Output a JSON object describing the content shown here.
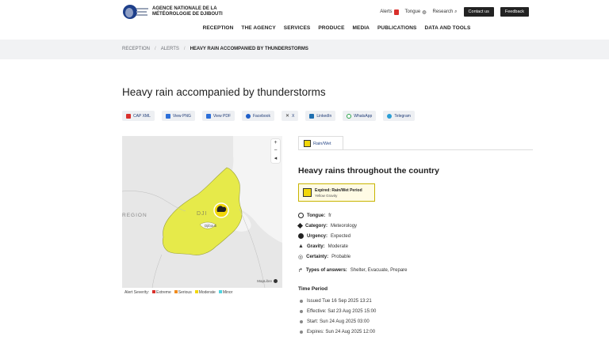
{
  "header": {
    "logo_text": "AGENCE NATIONALE DE LA MÉTÉOROLOGIE DE DJIBOUTI",
    "alerts_label": "Alerts",
    "tongue_label": "Tongue",
    "research_label": "Research",
    "contact_label": "Contact us",
    "feedback_label": "Feedback"
  },
  "nav": [
    "RECEPTION",
    "THE AGENCY",
    "SERVICES",
    "PRODUCE",
    "MEDIA",
    "PUBLICATIONS",
    "DATA AND TOOLS"
  ],
  "breadcrumb": {
    "home": "RECEPTION",
    "alerts": "ALERTS",
    "current": "HEAVY RAIN ACCOMPANIED BY THUNDERSTORMS"
  },
  "page_title": "Heavy rain accompanied by thunderstorms",
  "share_buttons": [
    {
      "label": "CAP XML",
      "icon": "file-icon",
      "color": "#d9302c"
    },
    {
      "label": "View PNG",
      "icon": "image-icon",
      "color": "#2c6fd9"
    },
    {
      "label": "View PDF",
      "icon": "pdf-icon",
      "color": "#2c6fd9"
    },
    {
      "label": "Facebook",
      "icon": "facebook-icon",
      "color": "#1f5fc9"
    },
    {
      "label": "X",
      "icon": "x-icon",
      "color": "#333333"
    },
    {
      "label": "LinkedIn",
      "icon": "linkedin-icon",
      "color": "#1f6fb0"
    },
    {
      "label": "WhatsApp",
      "icon": "whatsapp-icon",
      "color": "#2aa34a"
    },
    {
      "label": "Telegram",
      "icon": "telegram-icon",
      "color": "#2a9ed6"
    }
  ],
  "map": {
    "region_label": "REGION",
    "country_label": "DJI",
    "city_label": "Djibouti",
    "zoom_in": "+",
    "zoom_out": "−",
    "reset": "◂",
    "credit": "MapLibre"
  },
  "legend": {
    "title": "Alert Severity:",
    "items": [
      {
        "label": "Extreme",
        "color": "#d9302c"
      },
      {
        "label": "Serious",
        "color": "#f08c1e"
      },
      {
        "label": "Moderate",
        "color": "#f2d70a"
      },
      {
        "label": "Minor",
        "color": "#4fd3e0"
      }
    ]
  },
  "panel": {
    "tab_label": "Rain/Wet",
    "headline": "Heavy rains throughout the country",
    "status_title": "Expired: Rain/Wet Period",
    "status_sub": "Yellow Gravity",
    "properties": [
      {
        "key": "Tongue:",
        "value": "fr",
        "icon": "globe-icon"
      },
      {
        "key": "Category:",
        "value": "Meteorology",
        "icon": "tag-icon"
      },
      {
        "key": "Urgency:",
        "value": "Expected",
        "icon": "compass-icon"
      },
      {
        "key": "Gravity:",
        "value": "Moderate",
        "icon": "warning-icon"
      },
      {
        "key": "Certainty:",
        "value": "Probable",
        "icon": "target-icon"
      }
    ],
    "answers_key": "Types of answers:",
    "answers_value": "Shelter, Evacuate, Prepare",
    "time_period_title": "Time Period",
    "timeline": [
      "Issued Tue 16 Sep 2025 13:21",
      "Effective: Sat 23 Aug 2025 15:00",
      "Start: Sun 24 Aug 2025 03:00",
      "Expires: Sun 24 Aug 2025 12:00"
    ]
  },
  "colors": {
    "alert_yellow": "#e6ea4a",
    "nav_dark": "#222222"
  }
}
